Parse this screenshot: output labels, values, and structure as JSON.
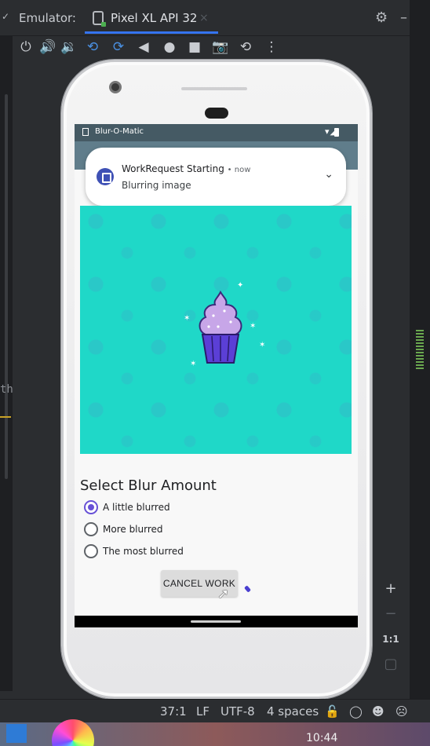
{
  "ide": {
    "emulator_label": "Emulator:",
    "device_tab": "Pixel XL API 32",
    "left_fragment": "th"
  },
  "emulator_toolbar": {
    "icons": [
      "power-icon",
      "volume-up-icon",
      "volume-down-icon",
      "rotate-left-icon",
      "rotate-right-icon",
      "back-icon",
      "home-icon",
      "overview-icon",
      "camera-icon",
      "snapshot-icon",
      "more-icon"
    ]
  },
  "zoom": {
    "zoom_in": "+",
    "zoom_out": "−",
    "actual": "1:1"
  },
  "statusbar": {
    "position": "37:1",
    "line_ending": "LF",
    "encoding": "UTF-8",
    "indent": "4 spaces"
  },
  "taskbar": {
    "clock": "10:44"
  },
  "app": {
    "name": "Blur-O-Matic",
    "notification": {
      "title": "WorkRequest Starting",
      "time": "• now",
      "body": "Blurring image"
    },
    "section_title": "Select Blur Amount",
    "options": [
      {
        "label": "A little blurred",
        "checked": true
      },
      {
        "label": "More blurred",
        "checked": false
      },
      {
        "label": "The most blurred",
        "checked": false
      }
    ],
    "cancel_button": "CANCEL WORK"
  },
  "colors": {
    "accent": "#6750d6",
    "image_bg": "#1fd8c8",
    "ide_accent": "#3574f0"
  }
}
